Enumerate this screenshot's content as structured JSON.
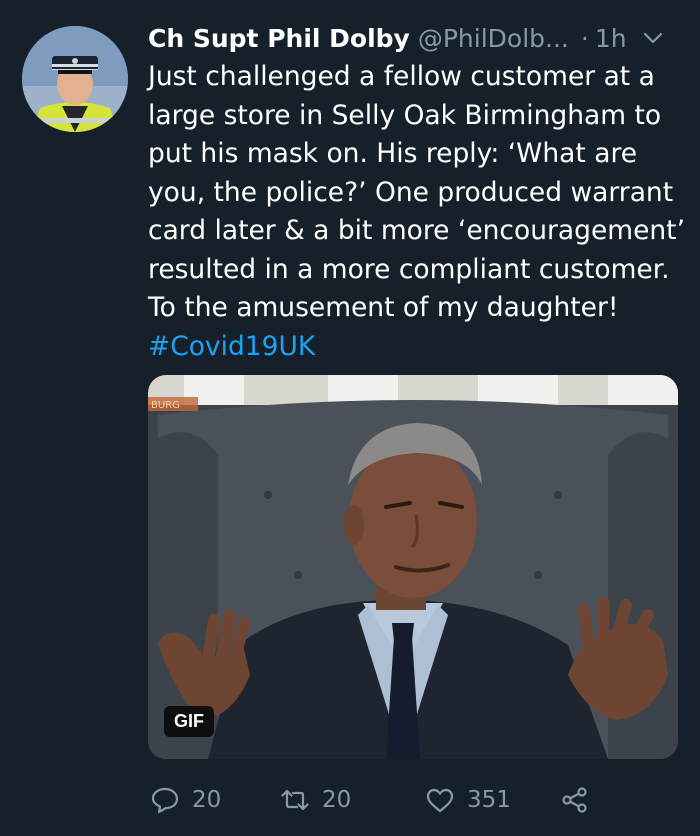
{
  "tweet": {
    "author": {
      "display_name": "Ch Supt Phil Dolby",
      "handle": "@PhilDolb...",
      "avatar_icon": "police-officer-avatar"
    },
    "separator": "·",
    "time": "1h",
    "menu_icon": "chevron-down-icon",
    "text_lines": [
      "Just challenged a fellow customer at a",
      "large store in Selly Oak Birmingham to",
      "put his mask on. His reply: ‘What are",
      "you, the police?’ One produced warrant",
      "card later & a bit more ‘encouragement’",
      "resulted in a more compliant customer.",
      "To the amusement of my daughter!"
    ],
    "hashtag": "#Covid19UK",
    "media": {
      "badge": "GIF",
      "watermark": "BURG"
    },
    "actions": {
      "replies": "20",
      "retweets": "20",
      "likes": "351"
    },
    "colors": {
      "background": "#15202b",
      "secondary_text": "#8899a6",
      "link": "#1da1f2"
    }
  }
}
